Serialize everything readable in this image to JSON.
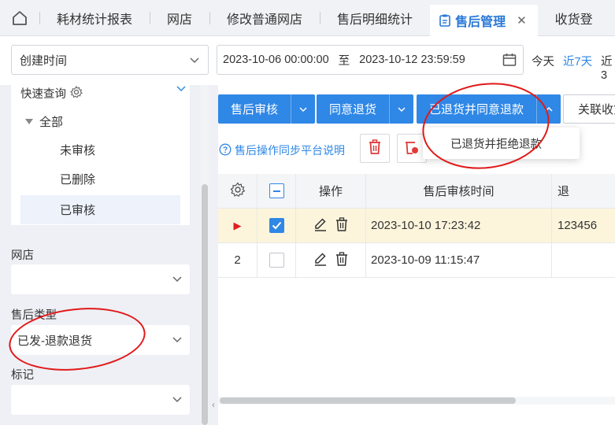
{
  "tabs": [
    {
      "label": "耗材统计报表"
    },
    {
      "label": "网店"
    },
    {
      "label": "修改普通网店"
    },
    {
      "label": "售后明细统计"
    },
    {
      "label": "售后管理",
      "active": true
    },
    {
      "label": "收货登"
    }
  ],
  "filter": {
    "time_field": "创建时间",
    "date_start": "2023-10-06 00:00:00",
    "date_sep": "至",
    "date_end": "2023-10-12 23:59:59",
    "quick": [
      {
        "label": "今天",
        "active": false
      },
      {
        "label": "近7天",
        "active": true
      },
      {
        "label": "近3",
        "active": false
      }
    ]
  },
  "left": {
    "quick_query_label": "快速查询",
    "tree_root": "全部",
    "tree_items": [
      {
        "label": "未审核",
        "selected": false
      },
      {
        "label": "已删除",
        "selected": false
      },
      {
        "label": "已审核",
        "selected": true
      }
    ],
    "shop_label": "网店",
    "shop_value": "",
    "aftersale_type_label": "售后类型",
    "aftersale_type_value": "已发-退款退货",
    "mark_label": "标记",
    "mark_value": ""
  },
  "toolbar": {
    "btn_audit": "售后审核",
    "btn_agree_return": "同意退货",
    "btn_returned_agree_refund": "已退货并同意退款",
    "btn_related": "关联收货",
    "dropdown_item": "已退货并拒绝退款",
    "help_link": "售后操作同步平台说明"
  },
  "table": {
    "headers": {
      "op": "操作",
      "audit_time": "售后审核时间",
      "next": "退"
    },
    "rows": [
      {
        "marker": "▶",
        "checked": true,
        "audit_time": "2023-10-10 17:23:42",
        "next": "123456",
        "highlight": true
      },
      {
        "marker": "2",
        "checked": false,
        "audit_time": "2023-10-09 11:15:47",
        "next": "",
        "highlight": false
      }
    ]
  },
  "colors": {
    "primary": "#2f87e6",
    "annotation": "#e11818",
    "row_highlight": "#fcf5dc"
  }
}
